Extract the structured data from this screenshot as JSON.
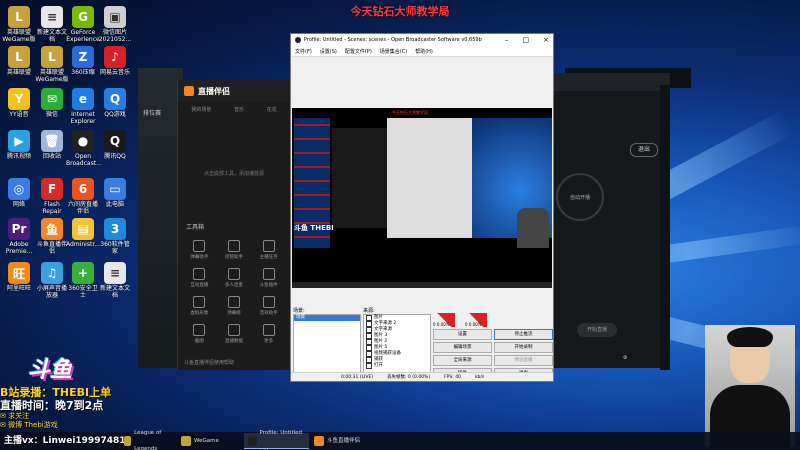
{
  "overlay_title": "今天钻石大师教学局",
  "desktop": {
    "icons": [
      {
        "label": "英雄联盟 WeGame版",
        "color": "#c7a23a",
        "glyph": "L"
      },
      {
        "label": "新建文本文档",
        "color": "#e7e7e7",
        "glyph": "≡"
      },
      {
        "label": "GeForce Experience",
        "color": "#76b900",
        "glyph": "G"
      },
      {
        "label": "微信图片 2021052...",
        "color": "#cfcfcf",
        "glyph": "▣"
      },
      {
        "label": "英雄联盟",
        "color": "#c7a23a",
        "glyph": "L"
      },
      {
        "label": "英雄联盟 WeGame版",
        "color": "#c7a23a",
        "glyph": "L"
      },
      {
        "label": "360压缩",
        "color": "#2a6bd8",
        "glyph": "Z"
      },
      {
        "label": "网易云音乐",
        "color": "#d8202a",
        "glyph": "♪"
      },
      {
        "label": "YY语音",
        "color": "#f3c21a",
        "glyph": "Y"
      },
      {
        "label": "微信",
        "color": "#2aae3a",
        "glyph": "✉"
      },
      {
        "label": "Internet Explorer",
        "color": "#1e7de0",
        "glyph": "e"
      },
      {
        "label": "QQ游戏",
        "color": "#2a7de0",
        "glyph": "Q"
      },
      {
        "label": "腾讯视频",
        "color": "#2aa0e0",
        "glyph": "▶"
      },
      {
        "label": "回收站",
        "color": "#9fb7d8",
        "glyph": "🗑"
      },
      {
        "label": "Open Broadcast...",
        "color": "#222222",
        "glyph": "●"
      },
      {
        "label": "腾讯QQ",
        "color": "#1a1a1a",
        "glyph": "Q"
      },
      {
        "label": "网络",
        "color": "#3a7de0",
        "glyph": "◎"
      },
      {
        "label": "Flash Repair",
        "color": "#d42a2a",
        "glyph": "F"
      },
      {
        "label": "六间房直播伴侣",
        "color": "#e8551f",
        "glyph": "6"
      },
      {
        "label": "此电脑",
        "color": "#3a7de0",
        "glyph": "▭"
      },
      {
        "label": "Adobe Premie...",
        "color": "#4a1f7a",
        "glyph": "Pr"
      },
      {
        "label": "斗鱼直播伴侣",
        "color": "#f2862a",
        "glyph": "鱼"
      },
      {
        "label": "Administr...",
        "color": "#f2c23a",
        "glyph": "▤"
      },
      {
        "label": "360软件管家",
        "color": "#1f8ad8",
        "glyph": "3"
      },
      {
        "label": "阿里旺旺",
        "color": "#f28a1a",
        "glyph": "旺"
      },
      {
        "label": "小屏声音播放器",
        "color": "#3aa0e0",
        "glyph": "♫"
      },
      {
        "label": "360安全卫士",
        "color": "#3ab03a",
        "glyph": "+"
      },
      {
        "label": "新建文本文档",
        "color": "#e7e7e7",
        "glyph": "≡"
      }
    ]
  },
  "launcher": {
    "title": "直播伴侣",
    "tabs": [
      "我的场景",
      "音乐",
      "花花"
    ],
    "empty_text": "点击底部工具，添加播放源",
    "tools_label": "工具箱",
    "tools": [
      {
        "label": "弹幕助手"
      },
      {
        "label": "房管助手"
      },
      {
        "label": "主播任务"
      },
      {
        "label": "互动直播"
      },
      {
        "label": "多人连麦"
      },
      {
        "label": "斗鱼插件"
      },
      {
        "label": "虚拟形象"
      },
      {
        "label": "弹幕姬"
      },
      {
        "label": "音效助手"
      },
      {
        "label": "截图"
      },
      {
        "label": "直播数据"
      },
      {
        "label": "更多"
      }
    ],
    "footer": "斗鱼直播伴侣使用帮助"
  },
  "gameclient": {
    "tab": "排位赛"
  },
  "right_app": {
    "user": "thebi",
    "exit_label": "退出",
    "auto_label": "自动开播",
    "stream_label": "开始直播"
  },
  "obs": {
    "title": "Profile: Untitled - Scenes: scenes - Open Broadcaster Software v0.659b",
    "menu": [
      "文件(F)",
      "设置(S)",
      "配置文件(P)",
      "场景集合(C)",
      "帮助(H)"
    ],
    "preview_title": "今天钻石大师教学局",
    "preview_brand": "斗鱼 THEBI",
    "scenes_label": "场景:",
    "sources_label": "来源:",
    "scenes": [
      "场景"
    ],
    "sources": [
      "图片",
      "文字来源 2",
      "文字来源",
      "图片 3",
      "图片 2",
      "图片 5",
      "视频捕获设备",
      "捕获",
      "打开"
    ],
    "meter_left": "0  0.00%",
    "meter_right": "0  0.00%",
    "buttons": [
      {
        "label": "设置",
        "state": "normal"
      },
      {
        "label": "停止推流",
        "state": "primary"
      },
      {
        "label": "编辑场景",
        "state": "normal"
      },
      {
        "label": "开始录制",
        "state": "normal"
      },
      {
        "label": "全局来源",
        "state": "normal"
      },
      {
        "label": "预览直播",
        "state": "disabled"
      },
      {
        "label": "插件",
        "state": "normal"
      },
      {
        "label": "退出",
        "state": "normal"
      }
    ],
    "status": {
      "time": "0:00:31 (LIVE)",
      "dropped": "丢失帧数: 0 (0.00%)",
      "fps": "FPS: 40",
      "bitrate": "kb/s"
    }
  },
  "overlay_text": {
    "logo": "斗鱼",
    "line1": "B站录播：THEBI上单",
    "line2": "直播时间：晚7到2点",
    "small1": "✉ 求关注",
    "small2": "✉ 微博 Thebi游戏"
  },
  "taskbar": {
    "contact": "主播vx：Linwei19997481",
    "items": [
      {
        "label": "League of Legends",
        "color": "#c7a23a"
      },
      {
        "label": "WeGame",
        "color": "#c7a23a"
      },
      {
        "label": "Profile: Untitled - ...",
        "color": "#222222"
      },
      {
        "label": "斗鱼直播伴侣",
        "color": "#f2862a"
      }
    ]
  }
}
